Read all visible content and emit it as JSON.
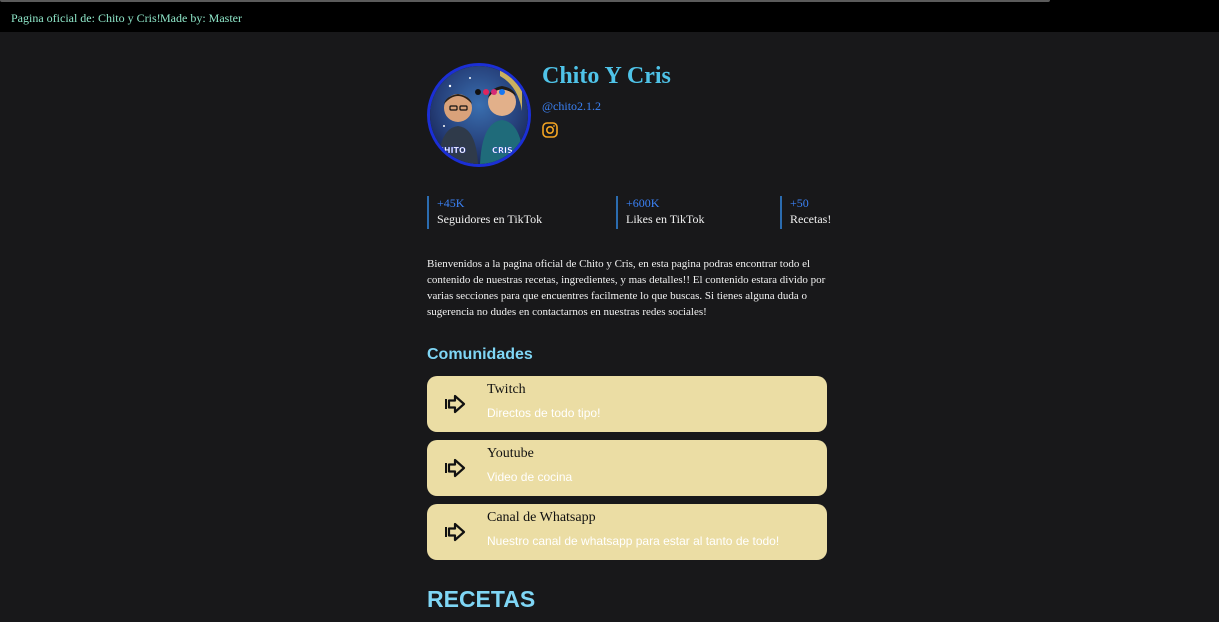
{
  "topbar": {
    "official": "Pagina oficial de: Chito y Cris!",
    "madeby": "Made by: Master"
  },
  "profile": {
    "name": "Chito Y Cris",
    "handle": "@chito2.1.2",
    "avatar_label_left": "CHITO",
    "avatar_label_right": "CRIS",
    "social_icon": "instagram-icon"
  },
  "stats": [
    {
      "value": "+45K",
      "label": "Seguidores en TikTok"
    },
    {
      "value": "+600K",
      "label": "Likes en TikTok"
    },
    {
      "value": "+50",
      "label": "Recetas!"
    }
  ],
  "description": "Bienvenidos a la pagina oficial de Chito y Cris, en esta pagina podras encontrar todo el contenido de nuestras recetas, ingredientes, y mas detalles!! El contenido estara divido por varias secciones para que encuentres facilmente lo que buscas. Si tienes alguna duda o sugerencia no dudes en contactarnos en nuestras redes sociales!",
  "communities": {
    "heading": "Comunidades",
    "items": [
      {
        "title": "Twitch",
        "subtitle": "Directos de todo tipo!",
        "icon": "arrow-right-icon"
      },
      {
        "title": "Youtube",
        "subtitle": "Video de cocina",
        "icon": "arrow-right-icon"
      },
      {
        "title": "Canal de Whatsapp",
        "subtitle": "Nuestro canal de whatsapp para estar al tanto de todo!",
        "icon": "arrow-right-icon"
      }
    ]
  },
  "recipes_heading": "RECETAS",
  "colors": {
    "background": "#18181a",
    "accent": "#4fc3e8",
    "link": "#3b82f6",
    "card": "#ebdda4",
    "instagram": "#f5a623"
  }
}
